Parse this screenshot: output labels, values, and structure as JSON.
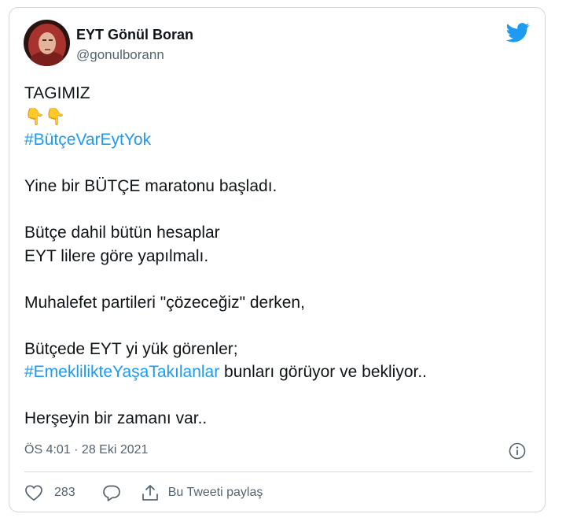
{
  "tweet": {
    "author_name": "EYT Gönül Boran",
    "author_handle": "@gonulborann",
    "lines": {
      "l1": "TAGIMIZ",
      "l2": "👇👇",
      "l3": "#BütçeVarEytYok",
      "l4": "Yine bir BÜTÇE maratonu başladı.",
      "l5": "Bütçe dahil bütün hesaplar",
      "l6": "EYT lilere göre yapılmalı.",
      "l7": "Muhalefet partileri \"çözeceğiz\" derken,",
      "l8": "Bütçede EYT yi yük görenler;",
      "l9_hashtag": "#EmeklilikteYaşaTakılanlar",
      "l9_rest": " bunları görüyor ve bekliyor..",
      "l10": "Herşeyin bir zamanı var.."
    },
    "timestamp": "ÖS 4:01 · 28 Eki 2021",
    "likes": "283",
    "share_label": "Bu Tweeti paylaş"
  },
  "colors": {
    "accent": "#1d9bf0",
    "text": "#0f1419",
    "muted": "#536471",
    "border": "#cfd9de"
  },
  "icons": [
    "twitter-bird-icon",
    "info-icon",
    "heart-icon",
    "reply-icon",
    "share-icon"
  ]
}
